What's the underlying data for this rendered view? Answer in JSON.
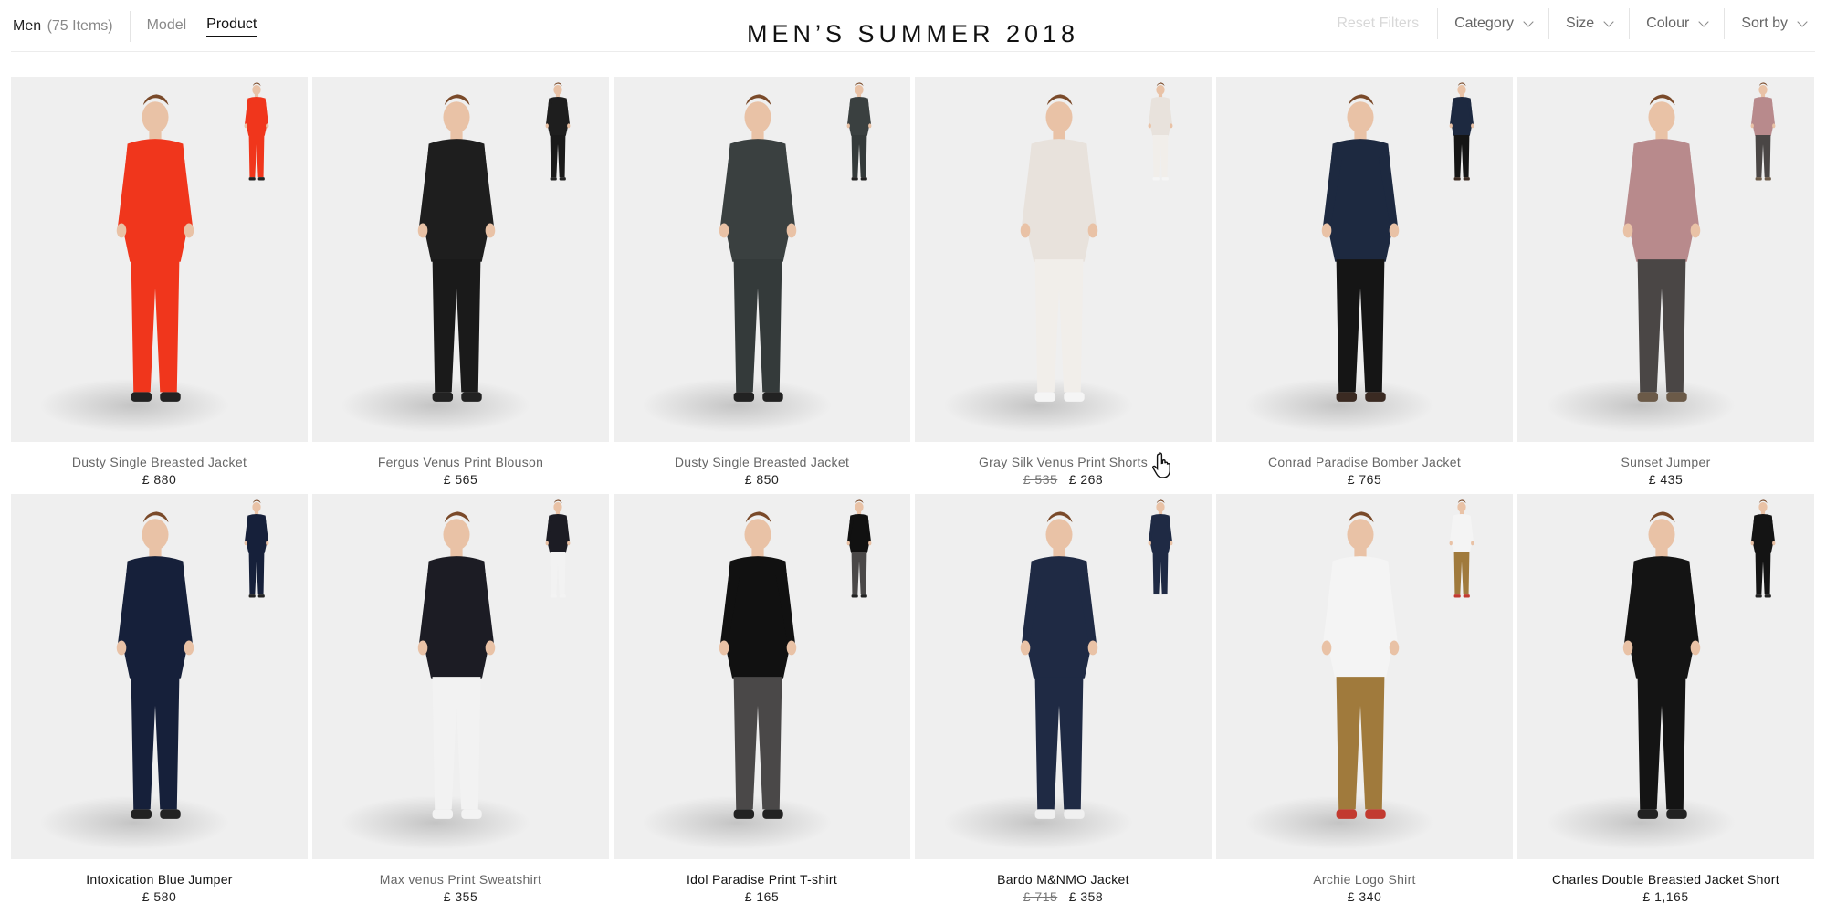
{
  "header": {
    "category": "Men",
    "count": "(75 Items)",
    "tabs": [
      {
        "label": "Model",
        "active": false
      },
      {
        "label": "Product",
        "active": true
      }
    ],
    "title": "MEN’S SUMMER 2018",
    "reset_label": "Reset Filters",
    "filters": [
      {
        "label": "Category",
        "icon": "chevron-down-icon"
      },
      {
        "label": "Size",
        "icon": "chevron-down-icon"
      },
      {
        "label": "Colour",
        "icon": "chevron-down-icon"
      },
      {
        "label": "Sort by",
        "icon": "chevron-down-icon"
      }
    ]
  },
  "products": [
    {
      "name": "Dusty Single Breasted Jacket",
      "price": "£ 880",
      "old_price": "",
      "colors": {
        "top": "#f0361c",
        "bottom": "#f0361c",
        "shoe": "#222222"
      }
    },
    {
      "name": "Fergus Venus Print Blouson",
      "price": "£ 565",
      "old_price": "",
      "colors": {
        "top": "#1e1e1e",
        "bottom": "#1a1a1a",
        "shoe": "#222222"
      }
    },
    {
      "name": "Dusty Single Breasted Jacket",
      "price": "£ 850",
      "old_price": "",
      "colors": {
        "top": "#3a4040",
        "bottom": "#343a3a",
        "shoe": "#222222"
      }
    },
    {
      "name": "Gray Silk Venus Print Shorts",
      "price": "£ 268",
      "old_price": "£ 535",
      "colors": {
        "top": "#e8e2dc",
        "bottom": "#f1eeea",
        "shoe": "#f5f5f5"
      }
    },
    {
      "name": "Conrad Paradise Bomber Jacket",
      "price": "£ 765",
      "old_price": "",
      "colors": {
        "top": "#1d2940",
        "bottom": "#151515",
        "shoe": "#3a2a22"
      }
    },
    {
      "name": "Sunset Jumper",
      "price": "£ 435",
      "old_price": "",
      "colors": {
        "top": "#b88a8c",
        "bottom": "#4a4645",
        "shoe": "#6b5a48"
      }
    },
    {
      "name": "Intoxication Blue Jumper",
      "price": "£ 580",
      "old_price": "",
      "colors": {
        "top": "#16203a",
        "bottom": "#16203a",
        "shoe": "#222222"
      },
      "dark": true
    },
    {
      "name": "Max venus Print Sweatshirt",
      "price": "£ 355",
      "old_price": "",
      "colors": {
        "top": "#1c1c24",
        "bottom": "#f2f2f2",
        "shoe": "#f3f3f3"
      }
    },
    {
      "name": "Idol Paradise Print T-shirt",
      "price": "£ 165",
      "old_price": "",
      "colors": {
        "top": "#111111",
        "bottom": "#4a4848",
        "shoe": "#222222"
      },
      "dark": true
    },
    {
      "name": "Bardo M&NMO Jacket",
      "price": "£ 358",
      "old_price": "£ 715",
      "colors": {
        "top": "#1f2a44",
        "bottom": "#1f2a44",
        "shoe": "#f0f0f0"
      },
      "dark": true
    },
    {
      "name": "Archie Logo Shirt",
      "price": "£ 340",
      "old_price": "",
      "colors": {
        "top": "#f4f4f4",
        "bottom": "#a07a3c",
        "shoe": "#c23a30"
      }
    },
    {
      "name": "Charles Double Breasted Jacket Short",
      "price": "£ 1,165",
      "old_price": "",
      "colors": {
        "top": "#141414",
        "bottom": "#141414",
        "shoe": "#222222"
      },
      "dark": true
    }
  ]
}
